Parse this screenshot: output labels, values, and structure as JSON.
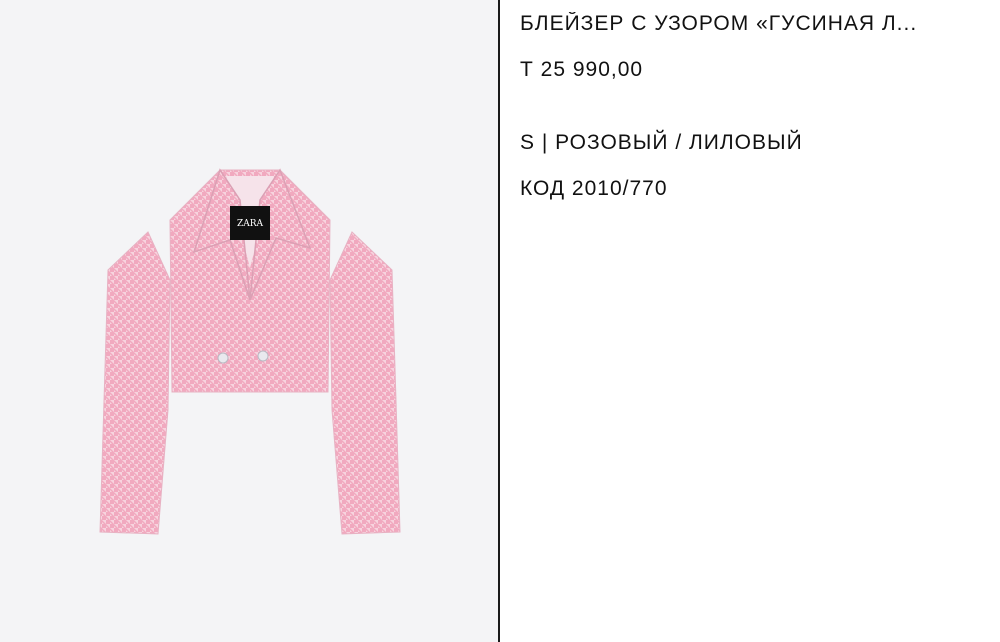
{
  "product": {
    "title": "БЛЕЙЗЕР С УЗОРОМ «ГУСИНАЯ Л...",
    "price": "Т 25 990,00",
    "variant": "S | РОЗОВЫЙ / ЛИЛОВЫЙ",
    "code": "КОД 2010/770",
    "image": {
      "label_brand": "ZARA",
      "garment_color": "#f0b8c8"
    }
  }
}
